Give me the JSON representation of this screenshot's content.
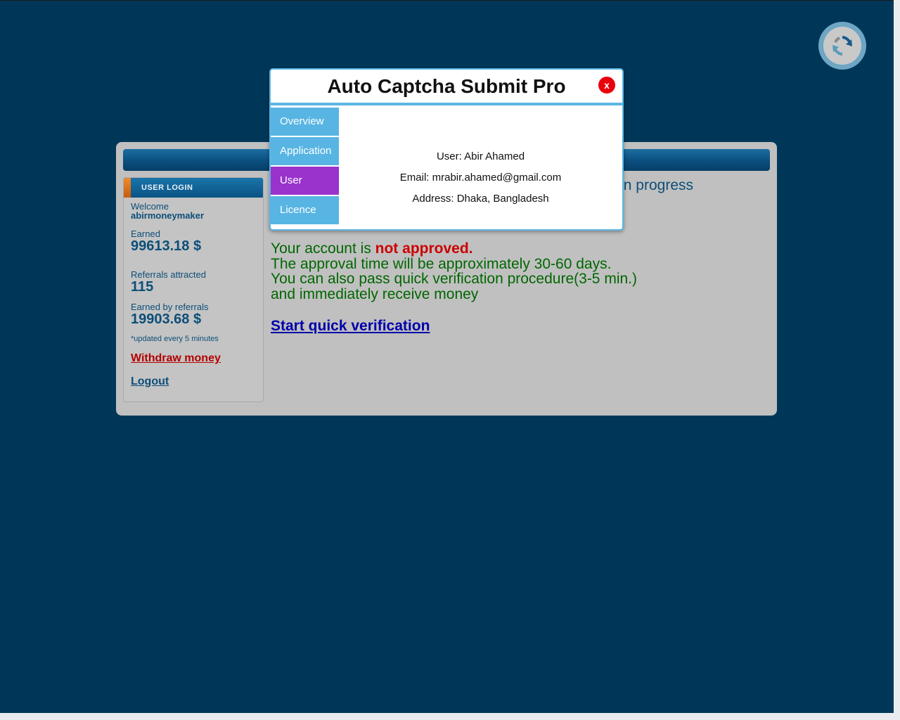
{
  "modal": {
    "title": "Auto Captcha Submit Pro",
    "close_label": "x",
    "tabs": [
      {
        "label": "Overview",
        "active": false
      },
      {
        "label": "Application",
        "active": false
      },
      {
        "label": "User",
        "active": true
      },
      {
        "label": "Licence",
        "active": false
      }
    ],
    "user_info": {
      "user": "User: Abir Ahamed",
      "email": "Email: mrabir.ahamed@gmail.com",
      "address": "Address: Dhaka, Bangladesh"
    }
  },
  "sidebar": {
    "header": "USER LOGIN",
    "welcome_label": "Welcome",
    "username": "abirmoneymaker",
    "earned_label": "Earned",
    "earned_value": "99613.18 $",
    "referrals_label": "Referrals attracted",
    "referrals_value": "115",
    "referral_earnings_label": "Earned by referrals",
    "referral_earnings_value": "19903.68 $",
    "update_note": "*updated every 5 minutes",
    "withdraw_label": "Withdraw money",
    "logout_label": "Logout"
  },
  "main": {
    "progress_fragment": "n progress",
    "status_prefix": "Your account is ",
    "status_highlight": "not approved.",
    "status_line2": "The approval time will be approximately 30-60 days.",
    "status_line3": "You can also pass quick verification procedure(3-5 min.)",
    "status_line4": "and immediately receive money",
    "verify_link": "Start quick verification"
  },
  "icons": {
    "captcha_logo": "recaptcha-logo-icon",
    "close": "close-icon"
  },
  "colors": {
    "page_background": "#003758",
    "tab_default": "#58b5e3",
    "tab_active": "#9933cc",
    "close_button": "#e8000b",
    "not_approved": "#cc0000",
    "status_text": "#006600",
    "link": "#0000aa",
    "withdraw": "#b30000"
  }
}
